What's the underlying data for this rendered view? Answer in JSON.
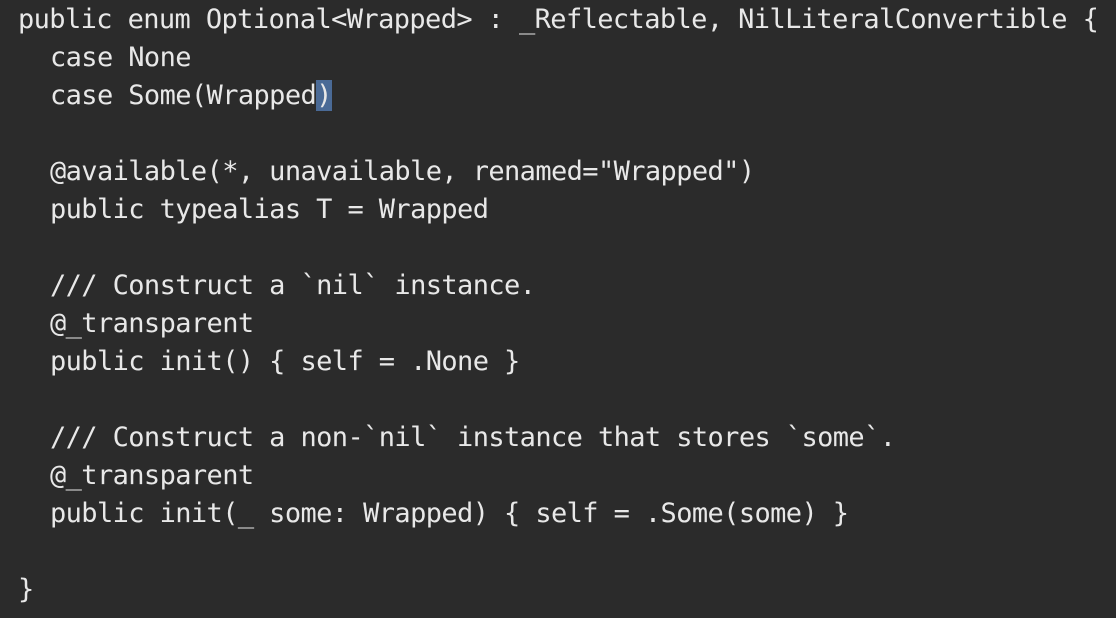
{
  "code_editor": {
    "language": "swift",
    "colors": {
      "background": "#2b2b2b",
      "text": "#e8e8e8",
      "selection": "#4a6a96"
    },
    "lines": [
      "public enum Optional<Wrapped> : _Reflectable, NilLiteralConvertible {",
      "case None",
      "case Some(Wrapped",
      "",
      "@available(*, unavailable, renamed=\"Wrapped\")",
      "public typealias T = Wrapped",
      "",
      "/// Construct a `nil` instance.",
      "@_transparent",
      "public init() { self = .None }",
      "",
      "/// Construct a non-`nil` instance that stores `some`.",
      "@_transparent",
      "public init(_ some: Wrapped) { self = .Some(some) }",
      "",
      "}"
    ],
    "selected_char": ")"
  }
}
